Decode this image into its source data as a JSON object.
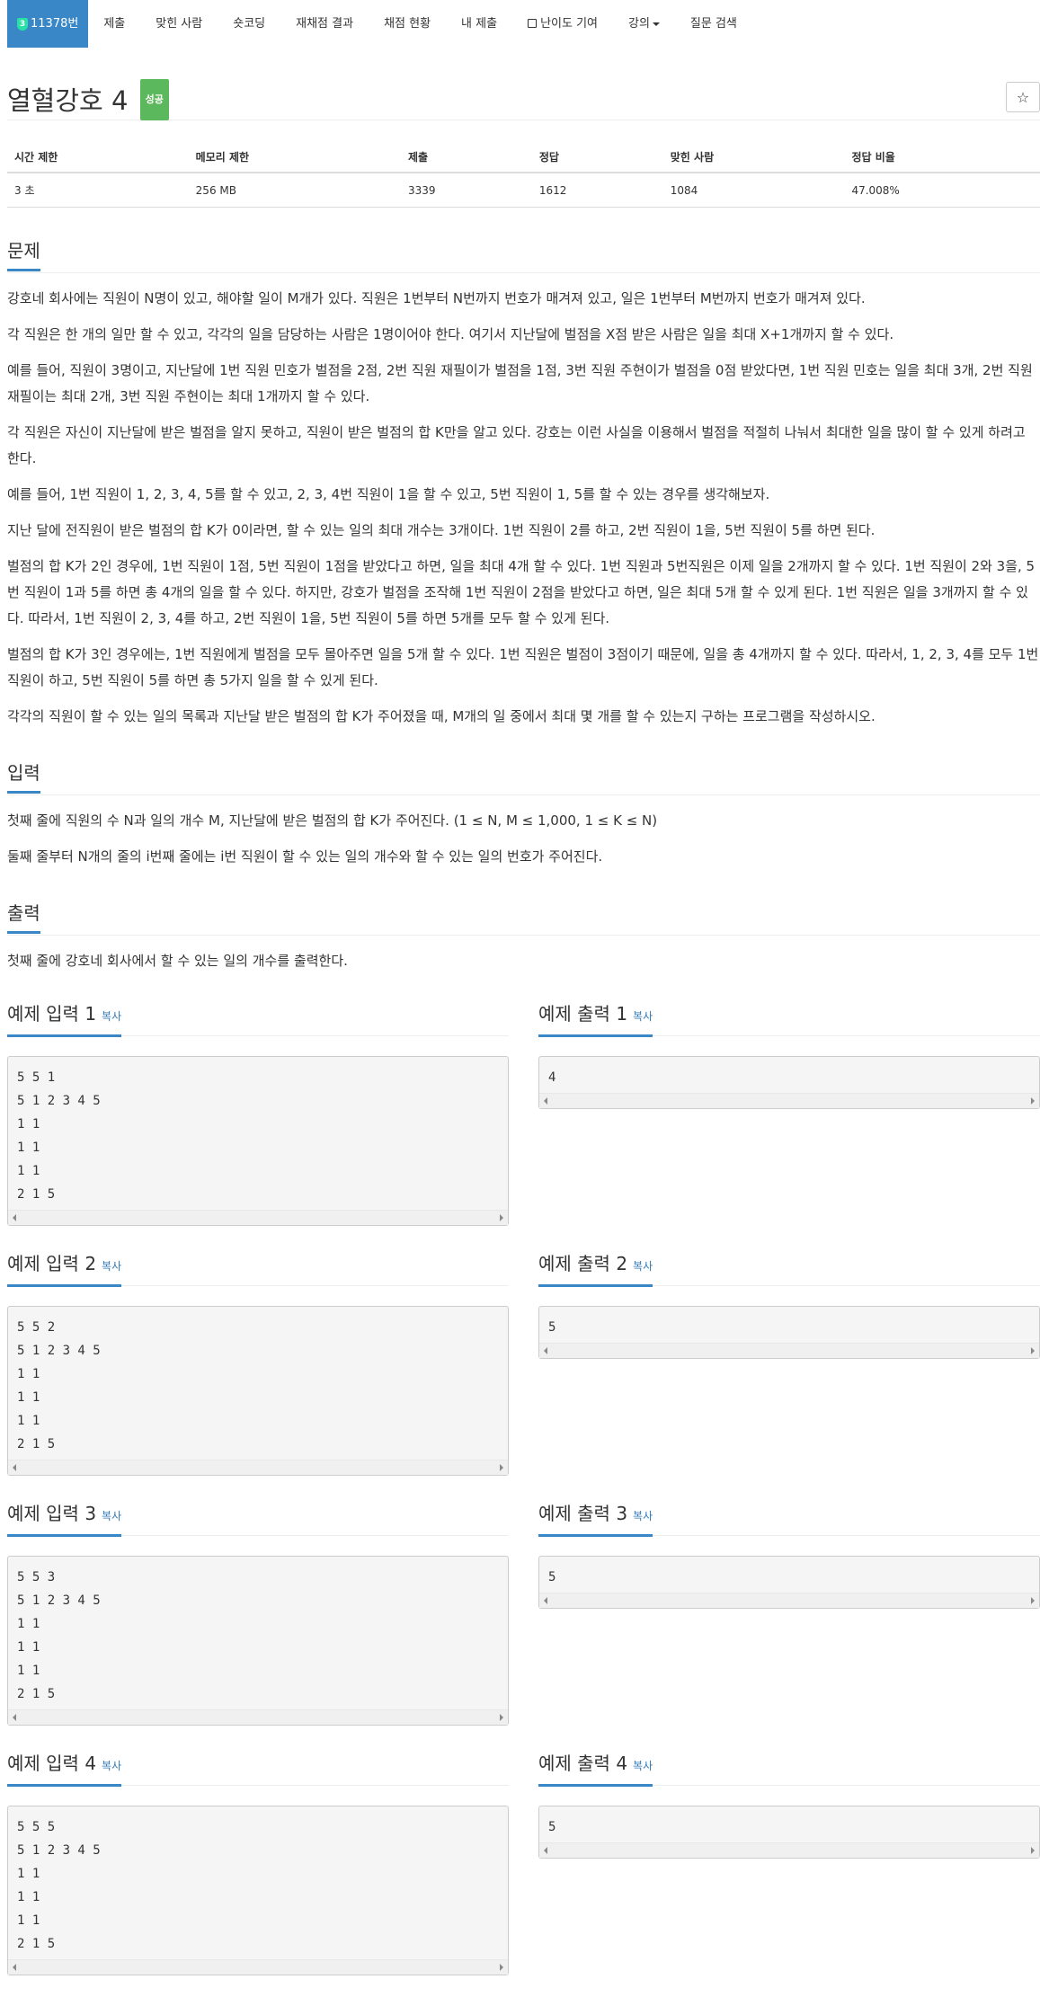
{
  "nav": {
    "problem_number": "11378번",
    "level_badge": "3",
    "items": [
      "제출",
      "맞힌 사람",
      "숏코딩",
      "재채점 결과",
      "채점 현황",
      "내 제출",
      "난이도 기여",
      "강의",
      "질문 검색"
    ]
  },
  "title": {
    "text": "열혈강호 4",
    "status": "성공",
    "star": "☆"
  },
  "info": {
    "headers": [
      "시간 제한",
      "메모리 제한",
      "제출",
      "정답",
      "맞힌 사람",
      "정답 비율"
    ],
    "values": [
      "3 초",
      "256 MB",
      "3339",
      "1612",
      "1084",
      "47.008%"
    ]
  },
  "problem": {
    "heading": "문제",
    "paragraphs": [
      "강호네 회사에는 직원이 N명이 있고, 해야할 일이 M개가 있다. 직원은 1번부터 N번까지 번호가 매겨져 있고, 일은 1번부터 M번까지 번호가 매겨져 있다.",
      "각 직원은 한 개의 일만 할 수 있고, 각각의 일을 담당하는 사람은 1명이어야 한다. 여기서 지난달에 벌점을 X점 받은 사람은 일을 최대 X+1개까지 할 수 있다.",
      "예를 들어, 직원이 3명이고, 지난달에 1번 직원 민호가 벌점을 2점, 2번 직원 재필이가 벌점을 1점, 3번 직원 주현이가 벌점을 0점 받았다면, 1번 직원 민호는 일을 최대 3개, 2번 직원 재필이는 최대 2개, 3번 직원 주현이는 최대 1개까지 할 수 있다.",
      "각 직원은 자신이 지난달에 받은 벌점을 알지 못하고, 직원이 받은 벌점의 합 K만을 알고 있다. 강호는 이런 사실을 이용해서 벌점을 적절히 나눠서 최대한 일을 많이 할 수 있게 하려고 한다.",
      "예를 들어, 1번 직원이 1, 2, 3, 4, 5를 할 수 있고, 2, 3, 4번 직원이 1을 할 수 있고, 5번 직원이 1, 5를 할 수 있는 경우를 생각해보자.",
      "지난 달에 전직원이 받은 벌점의 합 K가 0이라면, 할 수 있는 일의 최대 개수는 3개이다. 1번 직원이 2를 하고, 2번 직원이 1을, 5번 직원이 5를 하면 된다.",
      "벌점의 합 K가 2인 경우에, 1번 직원이 1점, 5번 직원이 1점을 받았다고 하면, 일을 최대 4개 할 수 있다. 1번 직원과 5번직원은 이제 일을 2개까지 할 수 있다. 1번 직원이 2와 3을, 5번 직원이 1과 5를 하면 총 4개의 일을 할 수 있다. 하지만, 강호가 벌점을 조작해 1번 직원이 2점을 받았다고 하면, 일은 최대 5개 할 수 있게 된다. 1번 직원은 일을 3개까지 할 수 있다. 따라서, 1번 직원이 2, 3, 4를 하고, 2번 직원이 1을, 5번 직원이 5를 하면 5개를 모두 할 수 있게 된다.",
      "벌점의 합 K가 3인 경우에는, 1번 직원에게 벌점을 모두 몰아주면 일을 5개 할 수 있다. 1번 직원은 벌점이 3점이기 때문에, 일을 총 4개까지 할 수 있다. 따라서, 1, 2, 3, 4를 모두 1번직원이 하고, 5번 직원이 5를 하면 총 5가지 일을 할 수 있게 된다.",
      "각각의 직원이 할 수 있는 일의 목록과 지난달 받은 벌점의 합 K가 주어졌을 때, M개의 일 중에서 최대 몇 개를 할 수 있는지 구하는 프로그램을 작성하시오."
    ]
  },
  "input": {
    "heading": "입력",
    "paragraphs": [
      "첫째 줄에 직원의 수 N과 일의 개수 M, 지난달에 받은 벌점의 합 K가 주어진다. (1 ≤ N, M ≤ 1,000, 1 ≤ K ≤ N)",
      "둘째 줄부터 N개의 줄의 i번째 줄에는 i번 직원이 할 수 있는 일의 개수와 할 수 있는 일의 번호가 주어진다."
    ]
  },
  "output": {
    "heading": "출력",
    "paragraphs": [
      "첫째 줄에 강호네 회사에서 할 수 있는 일의 개수를 출력한다."
    ]
  },
  "copy_label": "복사",
  "samples": [
    {
      "in_title": "예제 입력 1",
      "in": "5 5 1\n5 1 2 3 4 5\n1 1\n1 1\n1 1\n2 1 5",
      "out_title": "예제 출력 1",
      "out": "4"
    },
    {
      "in_title": "예제 입력 2",
      "in": "5 5 2\n5 1 2 3 4 5\n1 1\n1 1\n1 1\n2 1 5",
      "out_title": "예제 출력 2",
      "out": "5"
    },
    {
      "in_title": "예제 입력 3",
      "in": "5 5 3\n5 1 2 3 4 5\n1 1\n1 1\n1 1\n2 1 5",
      "out_title": "예제 출력 3",
      "out": "5"
    },
    {
      "in_title": "예제 입력 4",
      "in": "5 5 5\n5 1 2 3 4 5\n1 1\n1 1\n1 1\n2 1 5",
      "out_title": "예제 출력 4",
      "out": "5"
    }
  ],
  "colors": {
    "accent": "#3a87c8",
    "success": "#5cb85c",
    "link": "#337ab7"
  }
}
